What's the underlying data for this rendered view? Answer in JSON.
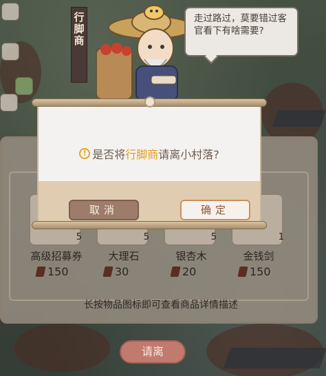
{
  "banner": {
    "title": "行脚商"
  },
  "speech": {
    "text": "走过路过，莫要错过客官看下有啥需要?"
  },
  "dialog": {
    "question_prefix": "是否将",
    "question_highlight": "行脚商",
    "question_suffix": "请离小村落?",
    "cancel_label": "取消",
    "confirm_label": "确定"
  },
  "shop": {
    "items": [
      {
        "name": "高级招募券",
        "qty": "5",
        "price": "150"
      },
      {
        "name": "大理石",
        "qty": "5",
        "price": "30"
      },
      {
        "name": "银杏木",
        "qty": "5",
        "price": "20"
      },
      {
        "name": "金钱剑",
        "qty": "1",
        "price": "150"
      }
    ],
    "hint": "长按物品图标即可查看商品详情描述"
  },
  "bottom": {
    "dismiss_label": "请离"
  },
  "colors": {
    "highlight": "#e29a1c",
    "cancel_button": "#9d7d69",
    "confirm_border": "#c98f5d",
    "dismiss_button": "#c27a6e"
  }
}
